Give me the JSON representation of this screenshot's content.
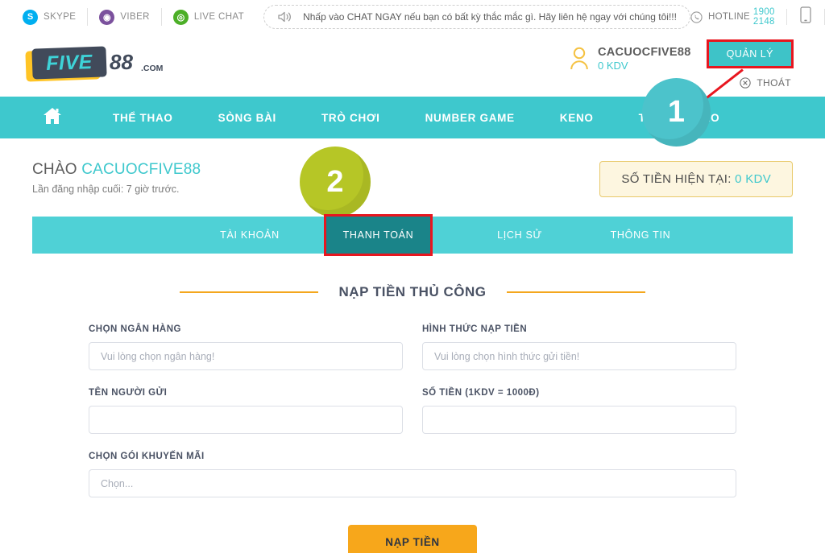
{
  "topbar": {
    "socials": [
      {
        "name": "SKYPE",
        "icon": "skype-icon",
        "glyph": "S"
      },
      {
        "name": "VIBER",
        "icon": "viber-icon",
        "glyph": "◉"
      },
      {
        "name": "LIVE CHAT",
        "icon": "whatsapp-icon",
        "glyph": "◎"
      }
    ],
    "chat_banner": "Nhấp vào CHAT NGAY nếu bạn có bất kỳ thắc mắc gì. Hãy liên hệ ngay với chúng tôi!!!",
    "hotline_label": "HOTLINE",
    "hotline_number": "1900 2148",
    "flag_star": "★"
  },
  "logo": {
    "five": "FIVE",
    "eighty_eight": "88",
    "com": ".COM"
  },
  "account": {
    "username": "CACUOCFIVE88",
    "balance": "0 KDV",
    "manage_label": "QUẢN LÝ",
    "logout_label": "THOÁT"
  },
  "nav": {
    "home_icon": "home-icon",
    "items": [
      {
        "label": "THỂ THAO"
      },
      {
        "label": "SÒNG BÀI"
      },
      {
        "label": "TRÒ CHƠI"
      },
      {
        "label": "NUMBER GAME"
      },
      {
        "label": "KENO"
      },
      {
        "label": "THỂ THAO ẢO"
      }
    ]
  },
  "greeting": {
    "hello": "CHÀO",
    "username": "CACUOCFIVE88",
    "last_login": "Lần đăng nhập cuối: 7 giờ trước.",
    "balance_label": "SỐ TIỀN HIỆN TẠI:",
    "balance_value": "0 KDV"
  },
  "tabs": [
    {
      "label": "TÀI KHOẢN",
      "active": false
    },
    {
      "label": "THANH TOÁN",
      "active": true
    },
    {
      "label": "LỊCH SỬ",
      "active": false
    },
    {
      "label": "THÔNG TIN",
      "active": false
    }
  ],
  "section": {
    "title": "NẠP TIỀN THỦ CÔNG"
  },
  "form": {
    "bank": {
      "label": "CHỌN NGÂN HÀNG",
      "placeholder": "Vui lòng chọn ngân hàng!",
      "value": ""
    },
    "method": {
      "label": "HÌNH THỨC NẠP TIỀN",
      "placeholder": "Vui lòng chọn hình thức gửi tiền!",
      "value": ""
    },
    "sender": {
      "label": "TÊN NGƯỜI GỬI",
      "placeholder": "",
      "value": ""
    },
    "amount": {
      "label": "SỐ TIỀN (1KDV = 1000Đ)",
      "placeholder": "",
      "value": ""
    },
    "promo": {
      "label": "CHỌN GÓI KHUYẾN MÃI",
      "placeholder": "Chọn...",
      "value": ""
    },
    "submit_label": "NẠP TIỀN"
  },
  "annotations": [
    {
      "number": "1",
      "color": "#4cc3cb"
    },
    {
      "number": "2",
      "color": "#b6c626"
    }
  ],
  "colors": {
    "teal": "#3ec8cd",
    "teal_light": "#4fd1d6",
    "teal_dark": "#1a8489",
    "orange": "#f7a71b",
    "red_highlight": "#e8161f",
    "slate": "#4a5264"
  }
}
